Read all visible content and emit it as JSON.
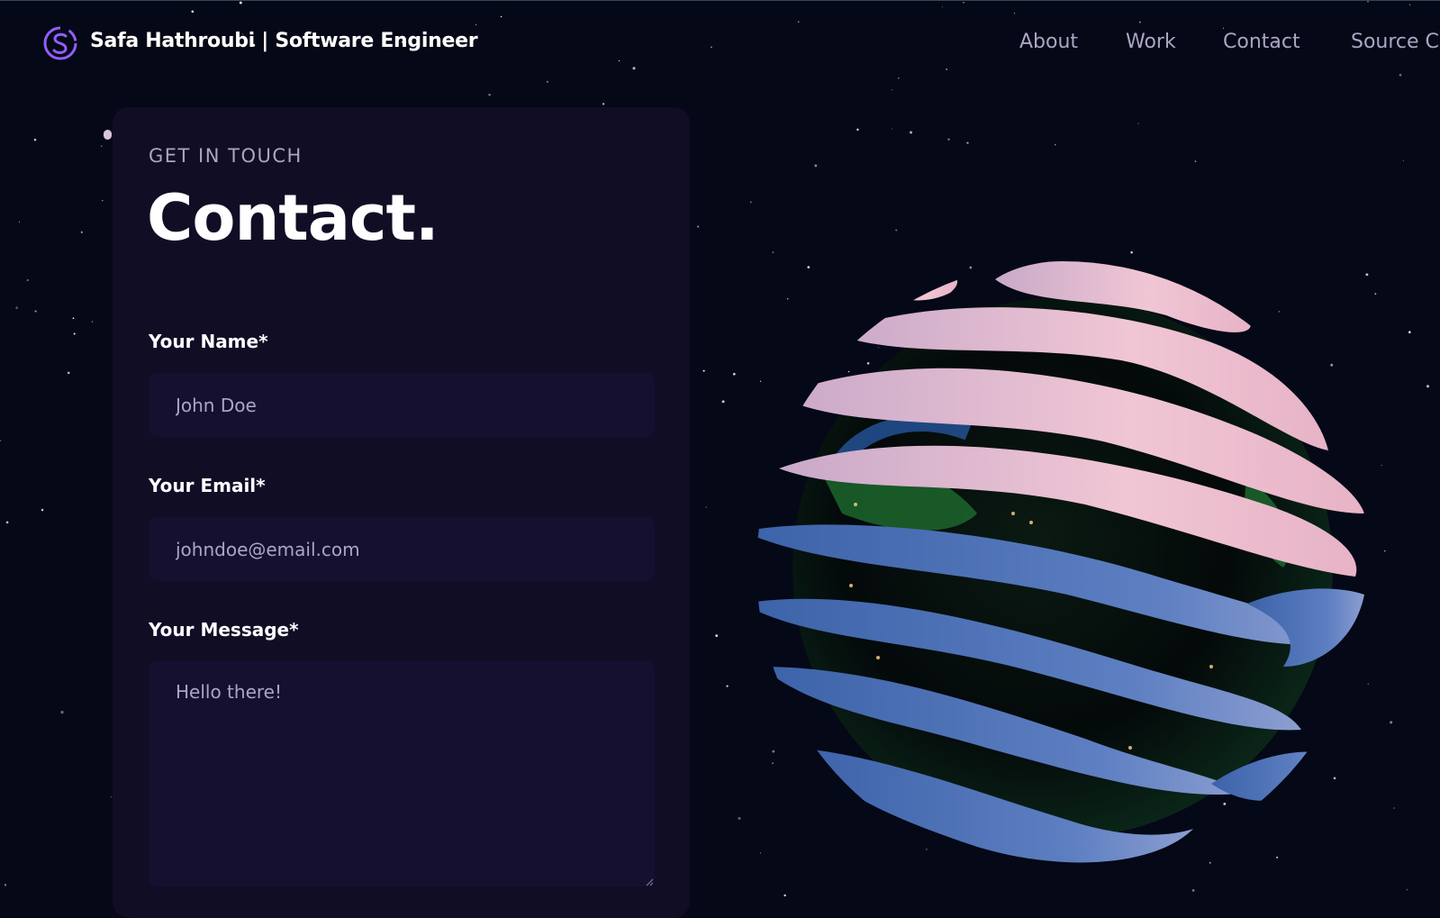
{
  "navbar": {
    "brand": "Safa Hathroubi | Software Engineer",
    "links": [
      "About",
      "Work",
      "Contact",
      "Source C"
    ]
  },
  "contact": {
    "eyebrow": "GET IN TOUCH",
    "heading": "Contact.",
    "fields": {
      "name": {
        "label": "Your Name*",
        "placeholder": "John Doe"
      },
      "email": {
        "label": "Your Email*",
        "placeholder": "johndoe@email.com"
      },
      "message": {
        "label": "Your Message*",
        "placeholder": "Hello there!"
      }
    }
  },
  "colors": {
    "background": "#050816",
    "card": "#100d25",
    "input": "#151030",
    "secondary_text": "#aaa6c3",
    "accent": "#915eff"
  }
}
